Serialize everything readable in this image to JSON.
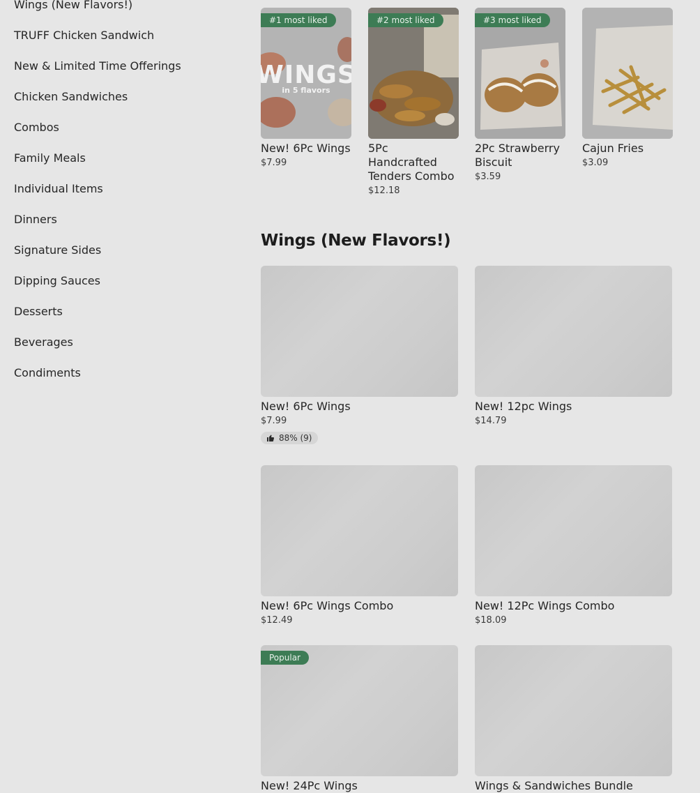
{
  "sidebar": {
    "items": [
      {
        "label": "Wings (New Flavors!)"
      },
      {
        "label": "TRUFF Chicken Sandwich"
      },
      {
        "label": "New & Limited Time Offerings"
      },
      {
        "label": "Chicken Sandwiches"
      },
      {
        "label": "Combos"
      },
      {
        "label": "Family Meals"
      },
      {
        "label": "Individual Items"
      },
      {
        "label": "Dinners"
      },
      {
        "label": "Signature Sides"
      },
      {
        "label": "Dipping Sauces"
      },
      {
        "label": "Desserts"
      },
      {
        "label": "Beverages"
      },
      {
        "label": "Condiments"
      }
    ]
  },
  "most_liked": [
    {
      "badge": "#1 most liked",
      "name": "New! 6Pc Wings",
      "price": "$7.99",
      "image_text_1": "WINGS",
      "image_text_2": "in 5 flavors"
    },
    {
      "badge": "#2 most liked",
      "name": "5Pc Handcrafted Tenders Combo",
      "price": "$12.18"
    },
    {
      "badge": "#3 most liked",
      "name": "2Pc Strawberry Biscuit",
      "price": "$3.59"
    },
    {
      "name": "Cajun Fries",
      "price": "$3.09"
    }
  ],
  "section": {
    "title": "Wings (New Flavors!)",
    "items": [
      {
        "name": "New! 6Pc Wings",
        "price": "$7.99",
        "rating": "88% (9)"
      },
      {
        "name": "New! 12pc Wings",
        "price": "$14.79"
      },
      {
        "name": "New! 6Pc Wings Combo",
        "price": "$12.49"
      },
      {
        "name": "New! 12Pc Wings Combo",
        "price": "$18.09"
      },
      {
        "badge": "Popular",
        "name": "New! 24Pc Wings"
      },
      {
        "name": "Wings & Sandwiches Bundle"
      }
    ]
  },
  "colors": {
    "badge_bg": "#3d7c55",
    "overlay_bg": "#e6e6e6"
  },
  "icons": {
    "rating": "thumbs-up-icon"
  }
}
